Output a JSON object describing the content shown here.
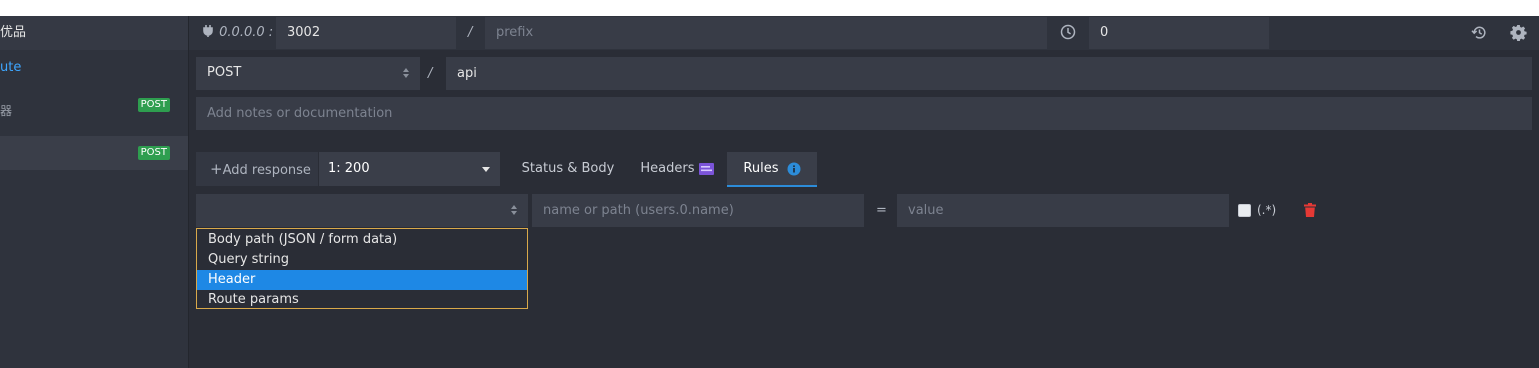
{
  "sidebar": {
    "title": "优品",
    "link": "ute",
    "routes": [
      {
        "badge": "POST",
        "sub": "器"
      },
      {
        "badge": "POST",
        "sub": ""
      }
    ]
  },
  "header": {
    "host": "0.0.0.0 :",
    "port": "3002",
    "slash": "/",
    "prefix_placeholder": "prefix",
    "latency": "0"
  },
  "route": {
    "method": "POST",
    "slash": "/",
    "path": "api",
    "notes_placeholder": "Add notes or documentation"
  },
  "responses": {
    "add_label": "Add response",
    "add_plus": "+",
    "selected": "1: 200"
  },
  "tabs": [
    {
      "label": "Status & Body"
    },
    {
      "label": "Headers"
    },
    {
      "label": "Rules"
    }
  ],
  "rule": {
    "target_value": "",
    "name_placeholder": "name or path (users.0.name)",
    "eq": "=",
    "value_placeholder": "value",
    "regex_label": "(.*)",
    "options": [
      "Body path (JSON / form data)",
      "Query string",
      "Header",
      "Route params"
    ],
    "highlighted_option": "Header"
  },
  "colors": {
    "accent": "#1e88e5",
    "post_badge": "#2e9e4f",
    "delete": "#e53935",
    "dropdown_border": "#d9a94a"
  }
}
